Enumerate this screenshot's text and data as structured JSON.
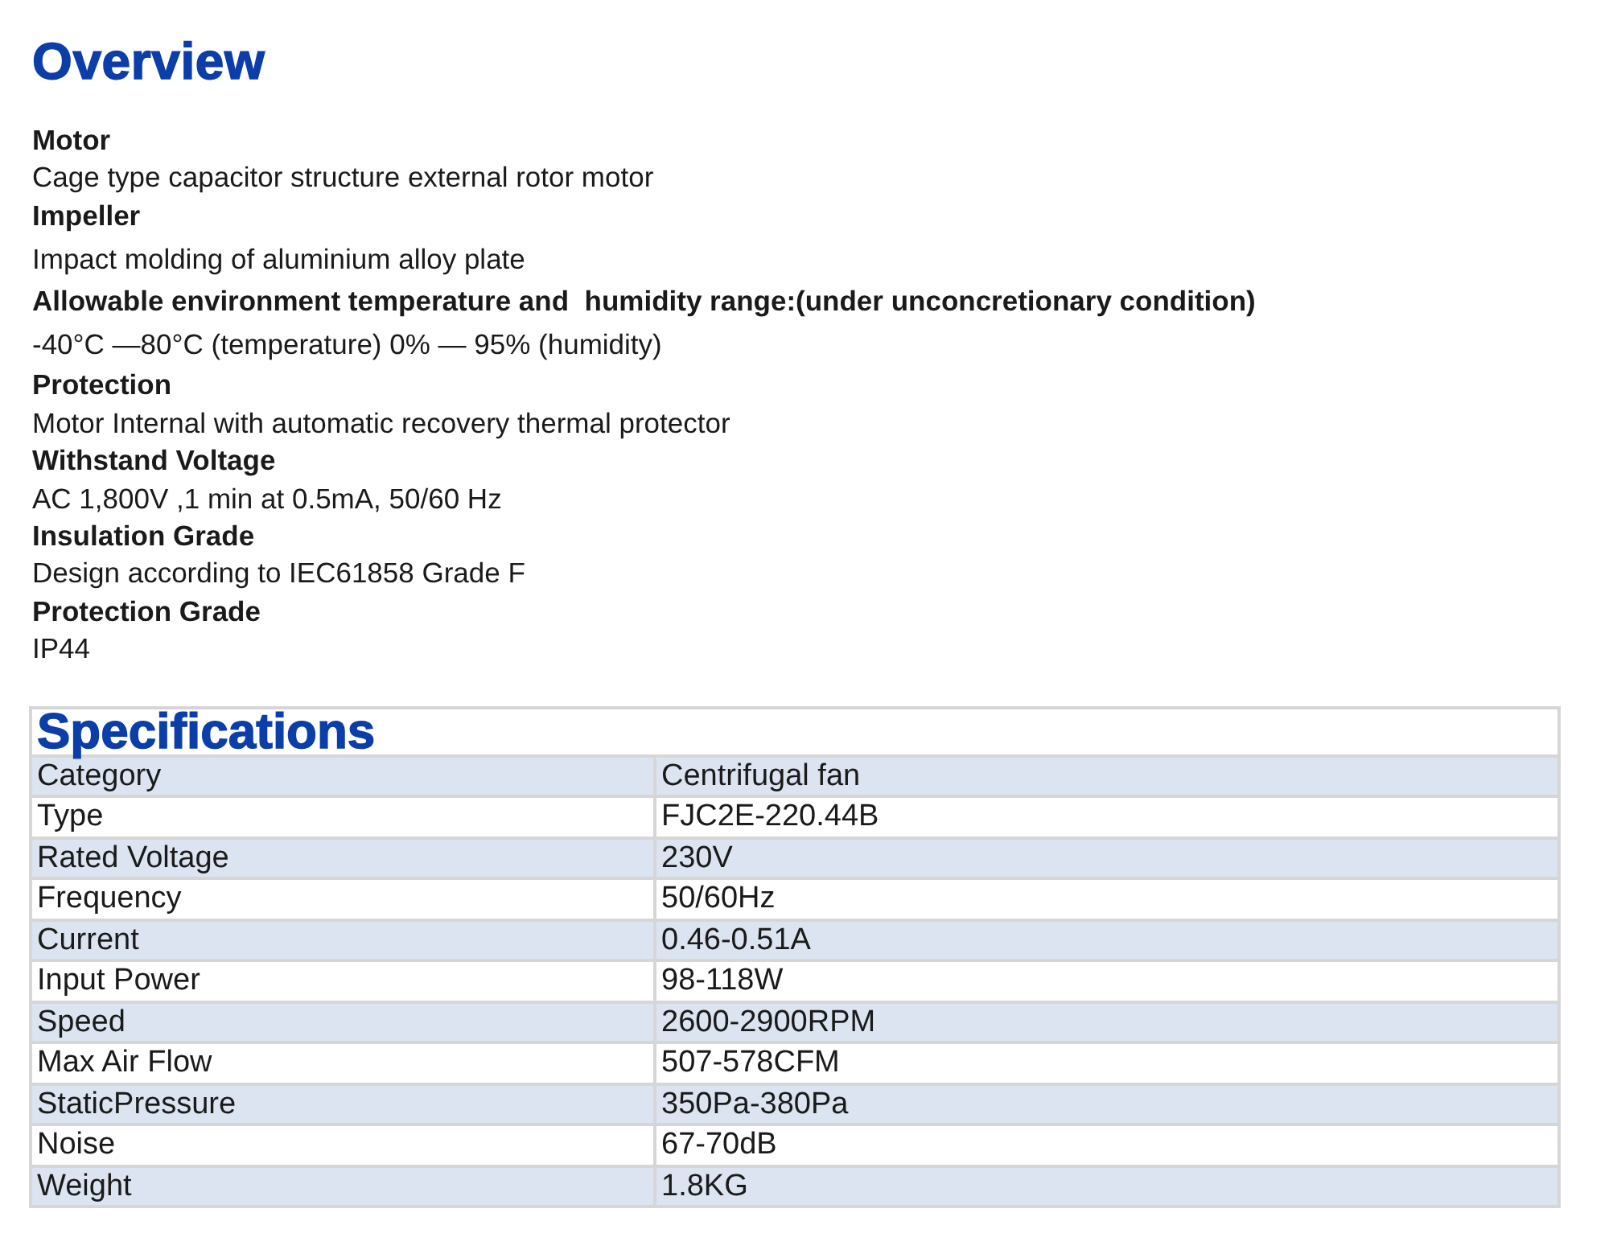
{
  "overview": {
    "title": "Overview",
    "sections": [
      {
        "label": "Motor",
        "value": "Cage type capacitor structure external rotor motor"
      },
      {
        "label": "Impeller",
        "value": "Impact molding of aluminium alloy plate"
      },
      {
        "label": "Allowable environment temperature and  humidity range:(under unconcretionary condition)",
        "value": "-40°C —80°C (temperature) 0% — 95% (humidity)"
      },
      {
        "label": "Protection",
        "value": "Motor Internal with automatic recovery thermal protector"
      },
      {
        "label": "Withstand Voltage",
        "value": "AC 1,800V ,1 min at 0.5mA, 50/60 Hz"
      },
      {
        "label": "Insulation Grade",
        "value": "Design according to IEC61858 Grade F"
      },
      {
        "label": "Protection Grade",
        "value": "IP44"
      }
    ]
  },
  "specifications": {
    "title": "Specifications",
    "rows": [
      [
        "Category",
        "Centrifugal fan"
      ],
      [
        "Type",
        "FJC2E-220.44B"
      ],
      [
        "Rated Voltage",
        "230V"
      ],
      [
        "Frequency",
        "50/60Hz"
      ],
      [
        "Current",
        "0.46-0.51A"
      ],
      [
        "Input Power",
        "98-118W"
      ],
      [
        "Speed",
        "2600-2900RPM"
      ],
      [
        "Max Air Flow",
        "507-578CFM"
      ],
      [
        "StaticPressure",
        "350Pa-380Pa"
      ],
      [
        "Noise",
        "67-70dB"
      ],
      [
        "Weight",
        "1.8KG"
      ]
    ]
  }
}
